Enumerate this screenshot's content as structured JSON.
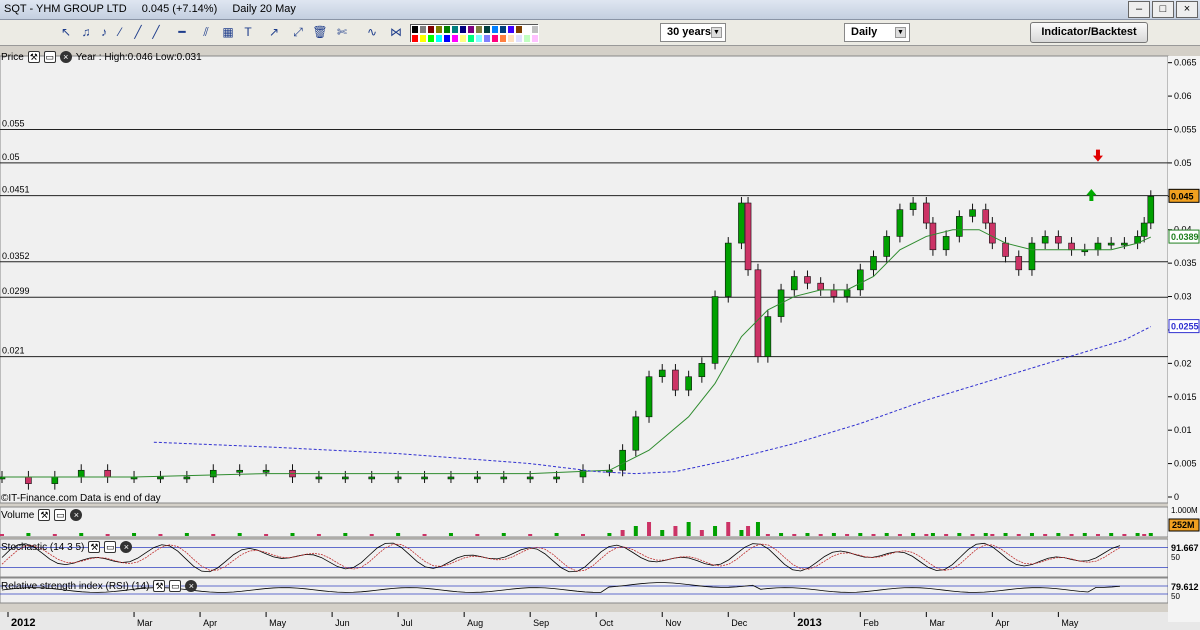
{
  "window": {
    "title_symbol": "SQT - YHM GROUP LTD",
    "title_price": "0.045 (+7.14%)",
    "title_period": "Daily  20 May"
  },
  "toolbar": {
    "range_value": "30 years",
    "interval_value": "Daily",
    "indicator_button": "Indicator/Backtest",
    "palette": [
      "#000000",
      "#7f7f7f",
      "#7f0000",
      "#7f7f00",
      "#007f00",
      "#007f7f",
      "#00007f",
      "#7f007f",
      "#7f7f3f",
      "#003f3f",
      "#007fff",
      "#003f7f",
      "#3f00ff",
      "#7f3f00",
      "#ffffff",
      "#c0c0c0",
      "#ff0000",
      "#ffff00",
      "#00ff00",
      "#00ffff",
      "#0000ff",
      "#ff00ff",
      "#ffff7f",
      "#00ff7f",
      "#7fffff",
      "#7f7fff",
      "#ff007f",
      "#ff7f3f",
      "#ffe0c0",
      "#e0e0ff",
      "#c0ffc0",
      "#ffc0ff"
    ]
  },
  "panes": {
    "price": {
      "label": "Price",
      "info": "Year : High:0.046 Low:0.031",
      "footer": "©IT-Finance.com  Data is end of day"
    },
    "volume": {
      "label": "Volume",
      "max_label": "1.000M",
      "current_label": "252M"
    },
    "stochastic": {
      "label": "Stochastic (14 3 5)",
      "current_label": "91.667",
      "tick": "50"
    },
    "rsi": {
      "label": "Relative strength index (RSI) (14)",
      "current_label": "79.612",
      "tick": "50"
    }
  },
  "chart_data": {
    "type": "candlestick",
    "x_labels": [
      {
        "label": "2012",
        "month": 0,
        "bold": true
      },
      {
        "label": "Mar",
        "month": 2
      },
      {
        "label": "Apr",
        "month": 3
      },
      {
        "label": "May",
        "month": 4
      },
      {
        "label": "Jun",
        "month": 5
      },
      {
        "label": "Jul",
        "month": 6
      },
      {
        "label": "Aug",
        "month": 7
      },
      {
        "label": "Sep",
        "month": 8
      },
      {
        "label": "Oct",
        "month": 9
      },
      {
        "label": "Nov",
        "month": 10
      },
      {
        "label": "Dec",
        "month": 11
      },
      {
        "label": "2013",
        "month": 12,
        "bold": true
      },
      {
        "label": "Feb",
        "month": 13
      },
      {
        "label": "Mar",
        "month": 14
      },
      {
        "label": "Apr",
        "month": 15
      },
      {
        "label": "May",
        "month": 16
      }
    ],
    "y_ticks": [
      "0.065",
      "0.06",
      "0.055",
      "0.05",
      "0.045",
      "0.04",
      "0.035",
      "0.03",
      "0.025",
      "0.02",
      "0.015",
      "0.01",
      "0.005",
      "0"
    ],
    "ylim": [
      0,
      0.066
    ],
    "horizontal_lines": [
      {
        "value": 0.055,
        "label": "0.055"
      },
      {
        "value": 0.05,
        "label": "0.05"
      },
      {
        "value": 0.0451,
        "label": "0.0451"
      },
      {
        "value": 0.0352,
        "label": "0.0352"
      },
      {
        "value": 0.0299,
        "label": "0.0299"
      },
      {
        "value": 0.021,
        "label": "0.021"
      }
    ],
    "markers": [
      {
        "type": "down-arrow",
        "color": "#e00000",
        "month": 16.6,
        "value": 0.0505
      },
      {
        "type": "up-arrow",
        "color": "#00aa00",
        "month": 16.5,
        "value": 0.0455
      }
    ],
    "price_label": {
      "value": 0.045,
      "text": "0.045"
    },
    "ma_short_label": {
      "value": 0.0389,
      "text": "0.0389"
    },
    "ma_long_label": {
      "value": 0.0255,
      "text": "0.0255"
    },
    "series": [
      {
        "name": "",
        "kind": "candles",
        "up_color": "#00a000",
        "down_color": "#cc3366",
        "points": [
          [
            0.0,
            0.003
          ],
          [
            0.4,
            0.002
          ],
          [
            0.8,
            0.003
          ],
          [
            1.2,
            0.004
          ],
          [
            1.6,
            0.003
          ],
          [
            2.0,
            0.003
          ],
          [
            2.4,
            0.003
          ],
          [
            2.8,
            0.003
          ],
          [
            3.2,
            0.004
          ],
          [
            3.6,
            0.004
          ],
          [
            4.0,
            0.004
          ],
          [
            4.4,
            0.003
          ],
          [
            4.8,
            0.003
          ],
          [
            5.2,
            0.003
          ],
          [
            5.6,
            0.003
          ],
          [
            6.0,
            0.003
          ],
          [
            6.4,
            0.003
          ],
          [
            6.8,
            0.003
          ],
          [
            7.2,
            0.003
          ],
          [
            7.6,
            0.003
          ],
          [
            8.0,
            0.003
          ],
          [
            8.4,
            0.003
          ],
          [
            8.8,
            0.004
          ],
          [
            9.2,
            0.004
          ],
          [
            9.4,
            0.007
          ],
          [
            9.6,
            0.012
          ],
          [
            9.8,
            0.018
          ],
          [
            10.0,
            0.019
          ],
          [
            10.2,
            0.016
          ],
          [
            10.4,
            0.018
          ],
          [
            10.6,
            0.02
          ],
          [
            10.8,
            0.03
          ],
          [
            11.0,
            0.038
          ],
          [
            11.2,
            0.044
          ],
          [
            11.3,
            0.034
          ],
          [
            11.45,
            0.021
          ],
          [
            11.6,
            0.027
          ],
          [
            11.8,
            0.031
          ],
          [
            12.0,
            0.033
          ],
          [
            12.2,
            0.032
          ],
          [
            12.4,
            0.031
          ],
          [
            12.6,
            0.03
          ],
          [
            12.8,
            0.031
          ],
          [
            13.0,
            0.034
          ],
          [
            13.2,
            0.036
          ],
          [
            13.4,
            0.039
          ],
          [
            13.6,
            0.043
          ],
          [
            13.8,
            0.044
          ],
          [
            14.0,
            0.041
          ],
          [
            14.1,
            0.037
          ],
          [
            14.3,
            0.039
          ],
          [
            14.5,
            0.042
          ],
          [
            14.7,
            0.043
          ],
          [
            14.9,
            0.041
          ],
          [
            15.0,
            0.038
          ],
          [
            15.2,
            0.036
          ],
          [
            15.4,
            0.034
          ],
          [
            15.6,
            0.038
          ],
          [
            15.8,
            0.039
          ],
          [
            16.0,
            0.038
          ],
          [
            16.2,
            0.037
          ],
          [
            16.4,
            0.037
          ],
          [
            16.6,
            0.038
          ],
          [
            16.8,
            0.038
          ],
          [
            17.0,
            0.038
          ],
          [
            17.2,
            0.039
          ],
          [
            17.3,
            0.041
          ],
          [
            17.4,
            0.045
          ]
        ]
      },
      {
        "name": "",
        "kind": "ma_short",
        "color": "#2e8b2e",
        "points": [
          [
            0.0,
            0.003
          ],
          [
            2.0,
            0.003
          ],
          [
            4.0,
            0.0035
          ],
          [
            6.0,
            0.0035
          ],
          [
            8.0,
            0.0035
          ],
          [
            9.2,
            0.004
          ],
          [
            9.8,
            0.007
          ],
          [
            10.4,
            0.012
          ],
          [
            10.8,
            0.017
          ],
          [
            11.2,
            0.024
          ],
          [
            11.6,
            0.028
          ],
          [
            12.0,
            0.03
          ],
          [
            12.4,
            0.031
          ],
          [
            12.8,
            0.031
          ],
          [
            13.2,
            0.033
          ],
          [
            13.6,
            0.037
          ],
          [
            14.0,
            0.039
          ],
          [
            14.4,
            0.04
          ],
          [
            14.8,
            0.04
          ],
          [
            15.2,
            0.038
          ],
          [
            15.6,
            0.037
          ],
          [
            16.0,
            0.037
          ],
          [
            16.4,
            0.037
          ],
          [
            16.8,
            0.037
          ],
          [
            17.2,
            0.038
          ],
          [
            17.4,
            0.0389
          ]
        ]
      },
      {
        "name": "",
        "kind": "ma_long",
        "color": "#3030d0",
        "points": [
          [
            2.3,
            0.0082
          ],
          [
            4.0,
            0.0075
          ],
          [
            6.0,
            0.0065
          ],
          [
            8.0,
            0.005
          ],
          [
            9.0,
            0.0038
          ],
          [
            9.6,
            0.0035
          ],
          [
            10.2,
            0.0038
          ],
          [
            11.0,
            0.0055
          ],
          [
            12.0,
            0.008
          ],
          [
            13.0,
            0.011
          ],
          [
            14.0,
            0.0145
          ],
          [
            15.0,
            0.0175
          ],
          [
            16.0,
            0.0205
          ],
          [
            17.0,
            0.0235
          ],
          [
            17.4,
            0.0255
          ]
        ]
      }
    ]
  }
}
